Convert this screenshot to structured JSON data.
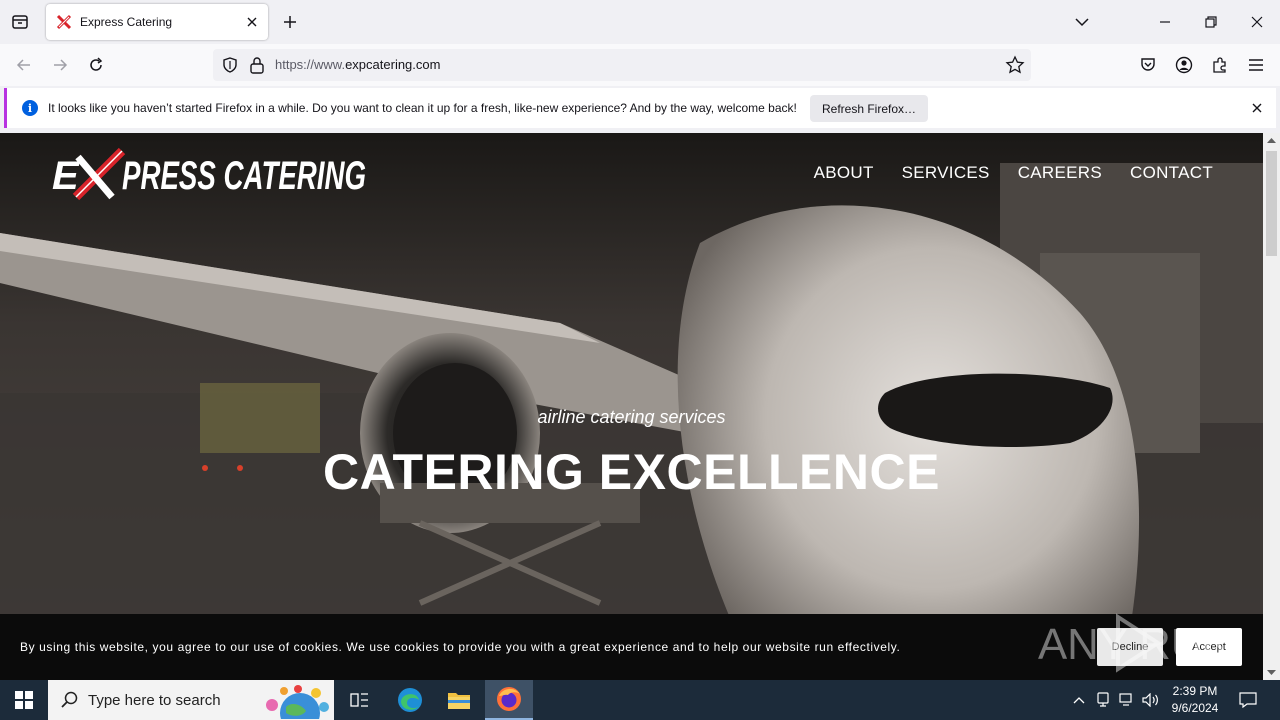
{
  "browser": {
    "tab_title": "Express Catering",
    "url_prefix": "https://www.",
    "url_domain": "expcatering.com"
  },
  "notification": {
    "message": "It looks like you haven’t started Firefox in a while. Do you want to clean it up for a fresh, like-new experience? And by the way, welcome back!",
    "button": "Refresh Firefox…"
  },
  "site": {
    "logo_text": "EXPRESS CATERING",
    "nav": [
      "ABOUT",
      "SERVICES",
      "CAREERS",
      "CONTACT"
    ],
    "tagline": "airline catering services",
    "headline": "CATERING EXCELLENCE"
  },
  "cookie": {
    "text": "By using this website, you agree to our use of cookies. We use cookies to provide you with a great experience and to help our website run effectively.",
    "decline": "Decline",
    "accept": "Accept"
  },
  "watermark": "ANY RUN",
  "taskbar": {
    "search_placeholder": "Type here to search",
    "time": "2:39 PM",
    "date": "9/6/2024"
  },
  "colors": {
    "accent": "#0060df",
    "notification_stripe": "#b833e1",
    "taskbar": "#1c2b3a",
    "logo_red": "#d8232a"
  }
}
